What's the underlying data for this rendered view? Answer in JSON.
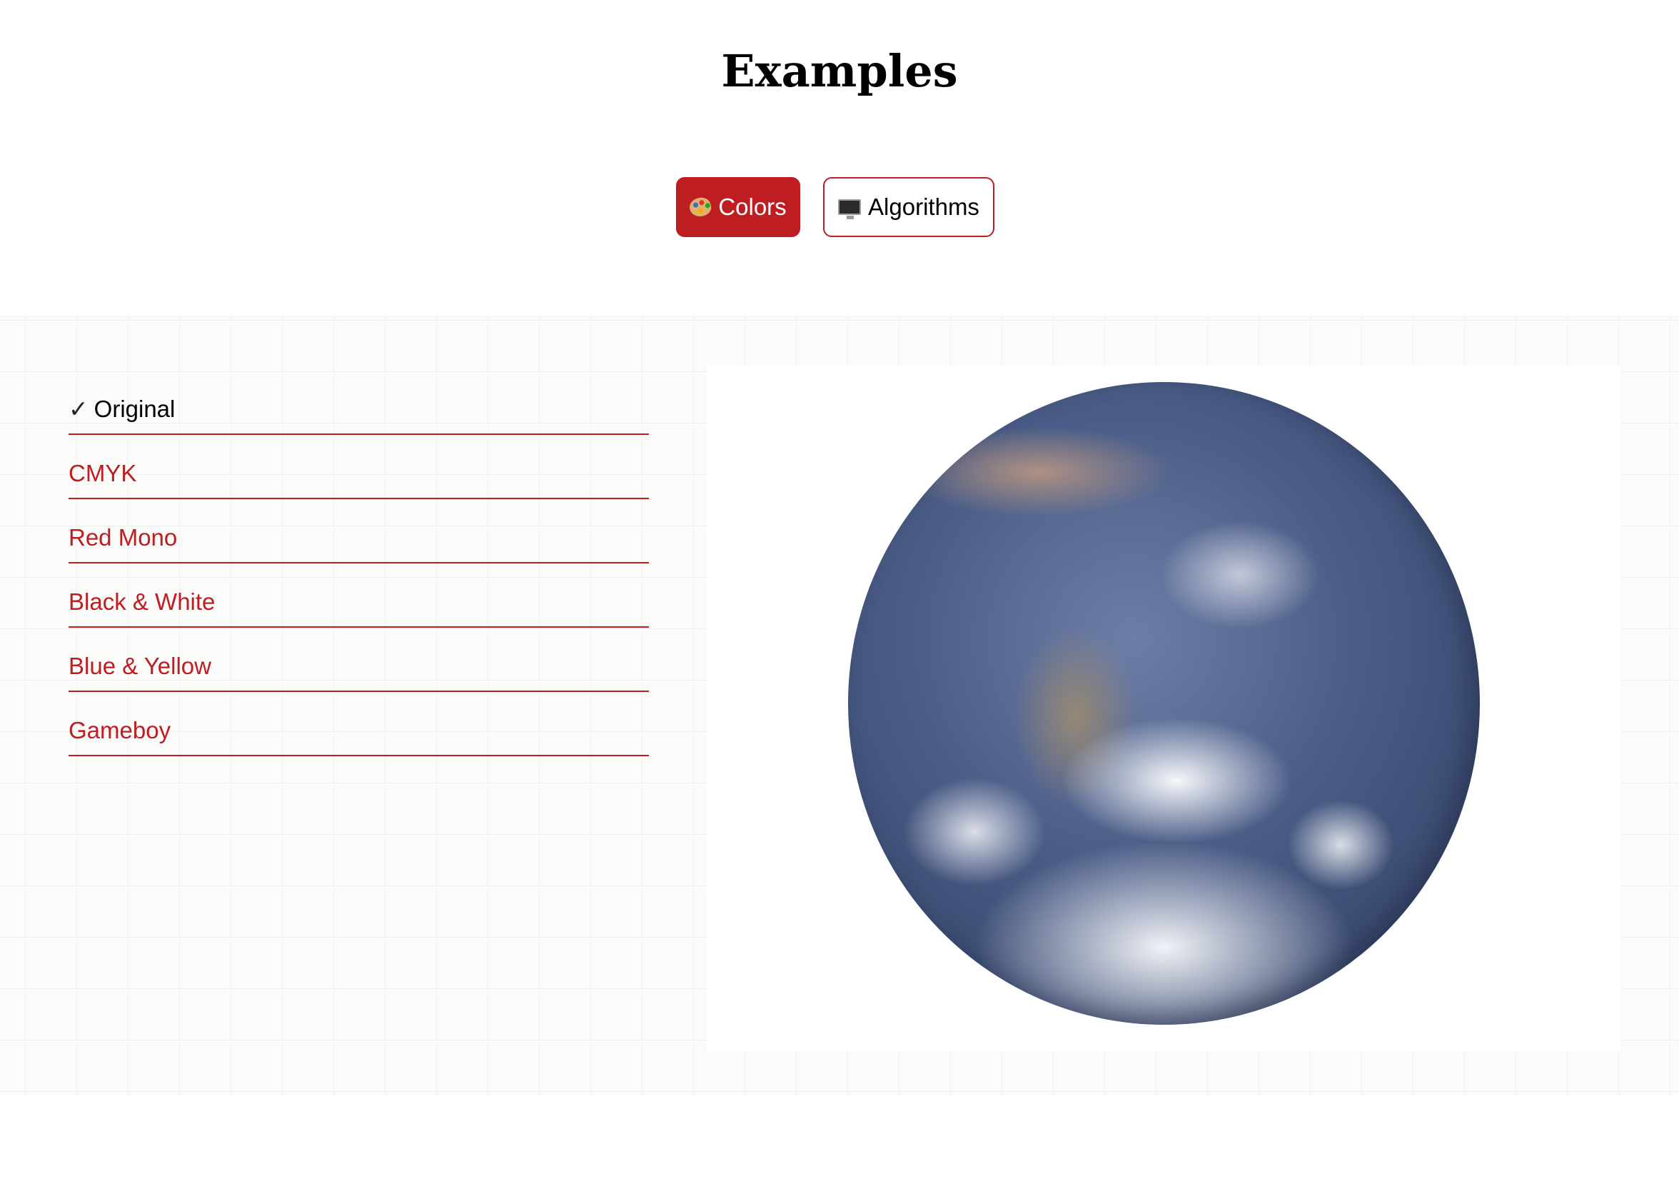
{
  "page": {
    "title": "Examples"
  },
  "tabs": [
    {
      "label": "Colors",
      "icon": "palette-icon",
      "active": true
    },
    {
      "label": "Algorithms",
      "icon": "computer-monitor-icon",
      "active": false
    }
  ],
  "options": [
    {
      "label": "Original",
      "selected": true
    },
    {
      "label": "CMYK",
      "selected": false
    },
    {
      "label": "Red Mono",
      "selected": false
    },
    {
      "label": "Black & White",
      "selected": false
    },
    {
      "label": "Blue & Yellow",
      "selected": false
    },
    {
      "label": "Gameboy",
      "selected": false
    }
  ],
  "check_mark": "✓",
  "preview": {
    "image": "earth-globe-image"
  },
  "colors": {
    "accent": "#be1d22",
    "text": "#000000",
    "background": "#ffffff",
    "stage_background": "#fbfcfa"
  }
}
